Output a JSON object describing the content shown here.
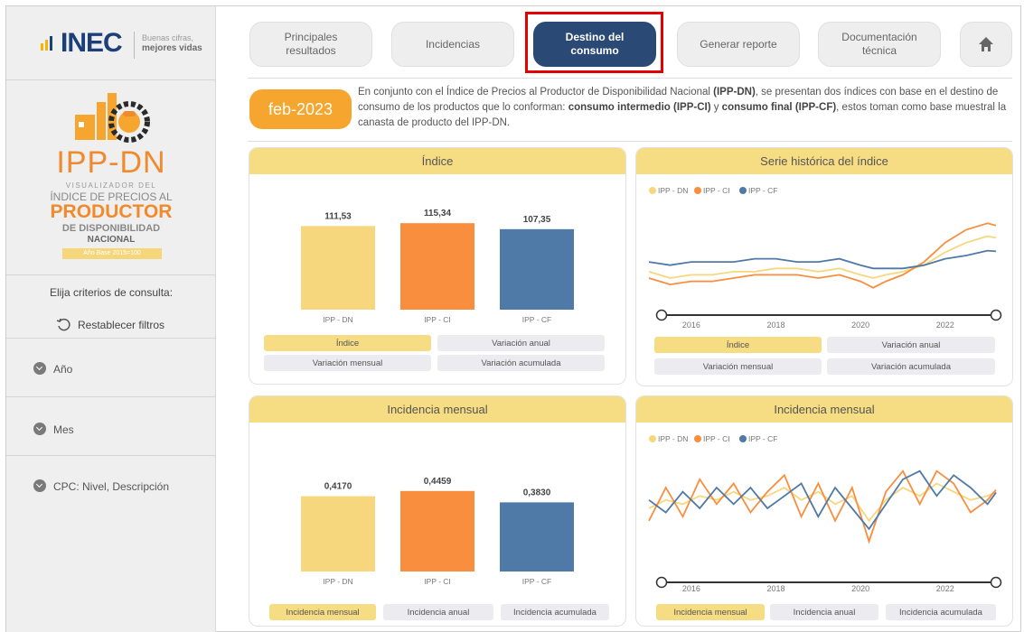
{
  "header": {
    "brand": "INEC",
    "tagline_1": "Buenas cifras,",
    "tagline_2": "mejores vidas"
  },
  "sidebar_logo": {
    "title": "IPP-DN",
    "line1": "VISUALIZADOR DEL",
    "line2": "ÍNDICE DE PRECIOS AL",
    "line3": "PRODUCTOR",
    "line4": "DE DISPONIBILIDAD",
    "line5": "NACIONAL",
    "base": "Año Base 2015=100"
  },
  "sidebar": {
    "criteria_label": "Elija criterios de consulta:",
    "reset_label": "Restablecer filtros",
    "filters": [
      "Año",
      "Mes",
      "CPC: Nivel, Descripción"
    ]
  },
  "nav": {
    "tabs": [
      {
        "label_1": "Principales",
        "label_2": "resultados"
      },
      {
        "label_1": "Incidencias",
        "label_2": ""
      },
      {
        "label_1": "Destino del",
        "label_2": "consumo"
      },
      {
        "label_1": "Generar reporte",
        "label_2": ""
      },
      {
        "label_1": "Documentación",
        "label_2": "técnica"
      }
    ],
    "active_index": 2
  },
  "date": "feb-2023",
  "description": {
    "p1": "En conjunto con el Índice de Precios al Productor de Disponibilidad Nacional ",
    "b1": "(IPP-DN)",
    "p2": ", se presentan dos índices con base en el destino de consumo de los productos que lo conforman: ",
    "b2": "consumo intermedio (IPP-CI)",
    "p3": " y ",
    "b3": "consumo final (IPP-CF)",
    "p4": ", estos toman como base muestral la canasta de producto del IPP-DN."
  },
  "colors": {
    "dn": "#f7d77e",
    "ci": "#f98e3f",
    "cf": "#4f79a7",
    "accent": "#f6a62e",
    "nav_active": "#2a4a75",
    "panel_header": "#f6dc82"
  },
  "panels": {
    "indice": {
      "title": "Índice",
      "buttons": [
        "Índice",
        "Variación anual",
        "Variación mensual",
        "Variación acumulada"
      ],
      "active": 0
    },
    "serie": {
      "title": "Serie histórica del índice",
      "buttons": [
        "Índice",
        "Variación anual",
        "Variación mensual",
        "Variación acumulada"
      ],
      "active": 0
    },
    "incidencia_bar": {
      "title": "Incidencia mensual",
      "buttons": [
        "Incidencia mensual",
        "Incidencia anual",
        "Incidencia acumulada"
      ],
      "active": 0
    },
    "incidencia_line": {
      "title": "Incidencia mensual",
      "buttons": [
        "Incidencia mensual",
        "Incidencia anual",
        "Incidencia acumulada"
      ],
      "active": 0
    }
  },
  "chart_data": [
    {
      "type": "bar",
      "title": "Índice",
      "categories": [
        "IPP - DN",
        "IPP - CI",
        "IPP - CF"
      ],
      "values": [
        111.53,
        115.34,
        107.35
      ],
      "value_labels": [
        "111,53",
        "115,34",
        "107,35"
      ],
      "ylim": [
        0,
        130
      ]
    },
    {
      "type": "line",
      "title": "Serie histórica del índice",
      "legend": [
        "IPP - DN",
        "IPP - CI",
        "IPP - CF"
      ],
      "x_ticks": [
        "2016",
        "2018",
        "2020",
        "2022"
      ],
      "x_range": [
        2015.0,
        2023.2
      ],
      "ylim": [
        92,
        120
      ],
      "series": [
        {
          "name": "IPP - DN",
          "x": [
            2015.0,
            2015.5,
            2016.0,
            2016.5,
            2017.0,
            2017.5,
            2018.0,
            2018.5,
            2019.0,
            2019.5,
            2020.0,
            2020.3,
            2020.6,
            2021.0,
            2021.5,
            2022.0,
            2022.5,
            2023.0,
            2023.2
          ],
          "values": [
            101,
            99,
            100,
            100,
            101,
            101,
            102,
            102,
            101,
            102,
            100,
            99,
            100,
            101,
            103,
            107,
            110,
            112,
            111.5
          ]
        },
        {
          "name": "IPP - CI",
          "x": [
            2015.0,
            2015.5,
            2016.0,
            2016.5,
            2017.0,
            2017.5,
            2018.0,
            2018.5,
            2019.0,
            2019.5,
            2020.0,
            2020.3,
            2020.6,
            2021.0,
            2021.5,
            2022.0,
            2022.5,
            2023.0,
            2023.2
          ],
          "values": [
            99,
            97,
            98,
            98,
            99,
            100,
            100,
            100,
            99,
            100,
            98,
            96,
            98,
            100,
            104,
            110,
            114,
            116,
            115.3
          ]
        },
        {
          "name": "IPP - CF",
          "x": [
            2015.0,
            2015.5,
            2016.0,
            2016.5,
            2017.0,
            2017.5,
            2018.0,
            2018.5,
            2019.0,
            2019.5,
            2020.0,
            2020.3,
            2020.6,
            2021.0,
            2021.5,
            2022.0,
            2022.5,
            2023.0,
            2023.2
          ],
          "values": [
            104,
            103,
            104,
            104,
            104,
            105,
            105,
            104,
            104,
            105,
            103,
            102,
            102,
            102,
            103,
            105,
            106,
            107.5,
            107.3
          ]
        }
      ]
    },
    {
      "type": "bar",
      "title": "Incidencia mensual",
      "categories": [
        "IPP - DN",
        "IPP - CI",
        "IPP - CF"
      ],
      "values": [
        0.417,
        0.4459,
        0.383
      ],
      "value_labels": [
        "0,4170",
        "0,4459",
        "0,3830"
      ],
      "ylim": [
        0,
        0.5
      ]
    },
    {
      "type": "line",
      "title": "Incidencia mensual",
      "legend": [
        "IPP - DN",
        "IPP - CI",
        "IPP - CF"
      ],
      "x_ticks": [
        "2016",
        "2018",
        "2020",
        "2022"
      ],
      "x_range": [
        2015.0,
        2023.2
      ],
      "ylim": [
        -1.2,
        1.2
      ],
      "series": [
        {
          "name": "IPP - DN",
          "x": [
            2015.0,
            2015.4,
            2015.8,
            2016.2,
            2016.6,
            2017.0,
            2017.4,
            2017.8,
            2018.2,
            2018.6,
            2019.0,
            2019.4,
            2019.8,
            2020.2,
            2020.6,
            2021.0,
            2021.4,
            2021.8,
            2022.2,
            2022.6,
            2023.0,
            2023.2
          ],
          "values": [
            0.0,
            0.2,
            0.1,
            0.3,
            0.2,
            0.4,
            0.2,
            0.3,
            0.5,
            0.2,
            0.4,
            0.1,
            0.3,
            -0.3,
            0.2,
            0.5,
            0.3,
            0.6,
            0.4,
            0.2,
            0.3,
            0.4
          ]
        },
        {
          "name": "IPP - CI",
          "x": [
            2015.0,
            2015.4,
            2015.8,
            2016.2,
            2016.6,
            2017.0,
            2017.4,
            2017.8,
            2018.2,
            2018.6,
            2019.0,
            2019.4,
            2019.8,
            2020.2,
            2020.6,
            2021.0,
            2021.4,
            2021.8,
            2022.2,
            2022.6,
            2023.0,
            2023.2
          ],
          "values": [
            -0.3,
            0.5,
            -0.2,
            0.7,
            0.1,
            0.6,
            -0.1,
            0.4,
            0.8,
            -0.2,
            0.6,
            -0.3,
            0.5,
            -0.8,
            0.4,
            0.9,
            0.1,
            0.9,
            0.6,
            -0.1,
            0.2,
            0.45
          ]
        },
        {
          "name": "IPP - CF",
          "x": [
            2015.0,
            2015.4,
            2015.8,
            2016.2,
            2016.6,
            2017.0,
            2017.4,
            2017.8,
            2018.2,
            2018.6,
            2019.0,
            2019.4,
            2019.8,
            2020.2,
            2020.6,
            2021.0,
            2021.4,
            2021.8,
            2022.2,
            2022.6,
            2023.0,
            2023.2
          ],
          "values": [
            0.2,
            -0.1,
            0.4,
            0.0,
            0.5,
            0.1,
            0.5,
            0.0,
            0.3,
            0.6,
            -0.2,
            0.5,
            0.0,
            -0.5,
            0.1,
            0.7,
            0.9,
            0.3,
            0.8,
            0.5,
            0.1,
            0.38
          ]
        }
      ]
    }
  ]
}
